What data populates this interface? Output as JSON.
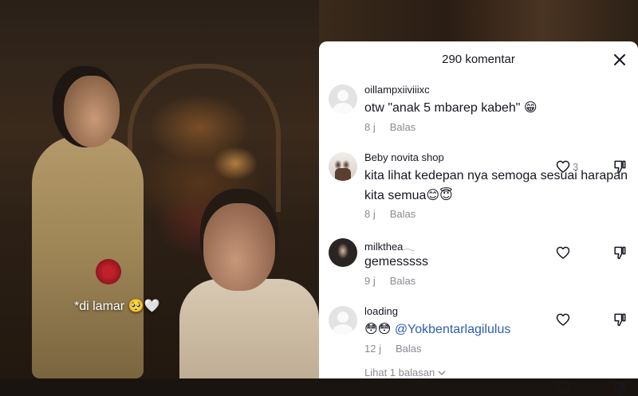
{
  "video": {
    "caption": "*di lamar",
    "caption_emoji": "🥺🤍"
  },
  "panel": {
    "title": "290 komentar",
    "close_icon": "close-icon"
  },
  "comments": [
    {
      "username": "oillampxiiviiixc",
      "text": "otw \"anak 5 mbarep kabeh\" 😁",
      "time": "8 j",
      "reply": "Balas",
      "likes": "3",
      "avatar": "default-avatar"
    },
    {
      "username": "Beby novita shop",
      "text": "kita lihat kedepan nya semoga sesuai harapan kita semua😊😇",
      "time": "8 j",
      "reply": "Balas",
      "likes": "",
      "avatar": "photo-avatar"
    },
    {
      "username": "milkthea𓂃",
      "text": "gemesssss",
      "time": "9 j",
      "reply": "Balas",
      "likes": "",
      "avatar": "dark-photo-avatar"
    },
    {
      "username": "loading",
      "text_emoji": "😳😳",
      "mention": "@Yokbentarlagilulus",
      "time": "12 j",
      "reply": "Balas",
      "likes": "",
      "avatar": "default-avatar"
    }
  ],
  "view_replies": "Lihat 1 balasan",
  "colors": {
    "text": "#161823",
    "meta": "#8a8b91",
    "mention": "#2b5db9"
  }
}
